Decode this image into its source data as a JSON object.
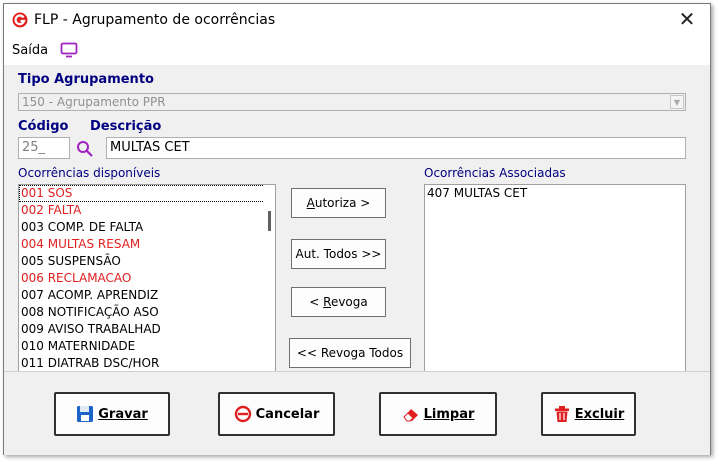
{
  "window": {
    "title": "FLP - Agrupamento de ocorrências",
    "close_glyph": "✕"
  },
  "menu": {
    "saida_label": "Saída"
  },
  "form": {
    "tipo_label": "Tipo Agrupamento",
    "tipo_value": "150 - Agrupamento PPR",
    "codigo_label": "Código",
    "codigo_value": "25_",
    "descricao_label": "Descrição",
    "descricao_value": "MULTAS CET"
  },
  "available": {
    "label": "Ocorrências disponíveis",
    "items": [
      {
        "text": "001 SOS",
        "color": "#e02020"
      },
      {
        "text": "002 FALTA",
        "color": "#e02020"
      },
      {
        "text": "003 COMP. DE FALTA",
        "color": "#000000"
      },
      {
        "text": "004 MULTAS RESAM",
        "color": "#e02020"
      },
      {
        "text": "005 SUSPENSÃO",
        "color": "#000000"
      },
      {
        "text": "006 RECLAMACAO",
        "color": "#e02020"
      },
      {
        "text": "007 ACOMP. APRENDIZ",
        "color": "#000000"
      },
      {
        "text": "008 NOTIFICAÇÃO ASO",
        "color": "#000000"
      },
      {
        "text": "009 AVISO TRABALHAD",
        "color": "#000000"
      },
      {
        "text": "010 MATERNIDADE",
        "color": "#000000"
      },
      {
        "text": "011 DIATRAB DSC/HOR",
        "color": "#000000"
      }
    ]
  },
  "associated": {
    "label": "Ocorrências Associadas",
    "items": [
      "407 MULTAS CET"
    ]
  },
  "middle_buttons": {
    "autoriza": "Autoriza >",
    "aut_todos": "Aut. Todos >>",
    "revoga": "< Revoga",
    "revoga_todos": "<< Revoga Todos"
  },
  "bottom_buttons": {
    "gravar": "Gravar",
    "cancelar": "Cancelar",
    "limpar": "Limpar",
    "excluir": "Excluir"
  },
  "icons": {
    "app": "app-logo-icon",
    "monitor": "monitor-icon",
    "search": "search-icon",
    "save": "floppy-disk-icon",
    "cancel": "no-entry-icon",
    "clear": "eraser-icon",
    "delete": "trash-icon"
  },
  "colors": {
    "accent_purple": "#a020c0",
    "label_navy": "#000080",
    "red_item": "#e02020"
  }
}
